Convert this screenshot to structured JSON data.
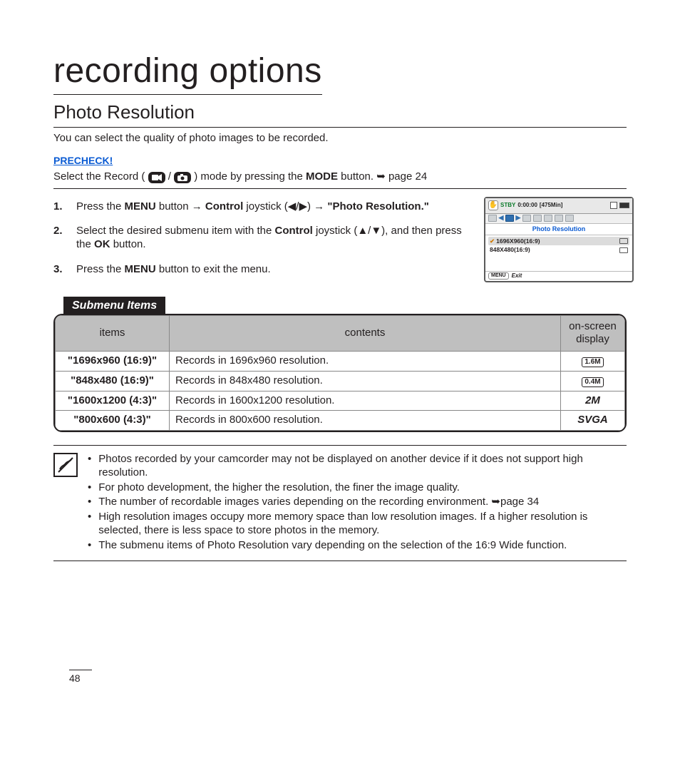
{
  "page_number": "48",
  "title": "recording options",
  "section": "Photo Resolution",
  "intro": "You can select the quality of photo images to be recorded.",
  "precheck_label": "PRECHECK!",
  "modeline": {
    "pre": "Select the Record ( ",
    "sep": " / ",
    "post": " ) mode by pressing the ",
    "mode_word": "MODE",
    "tail": " button. ",
    "pageref": "page 24"
  },
  "steps": [
    {
      "num": "1.",
      "parts": [
        "Press the ",
        "MENU",
        " button ",
        "→",
        " ",
        "Control",
        " joystick (◀/▶) ",
        "→",
        " ",
        "\"Photo Resolution.\""
      ],
      "bold_idx": [
        1,
        5,
        9
      ]
    },
    {
      "num": "2.",
      "parts": [
        "Select the desired submenu item with the ",
        "Control",
        " joystick (▲/▼), and then press the ",
        "OK",
        " button."
      ],
      "bold_idx": [
        1,
        3
      ]
    },
    {
      "num": "3.",
      "parts": [
        "Press the ",
        "MENU",
        " button to exit the menu."
      ],
      "bold_idx": [
        1
      ]
    }
  ],
  "screen": {
    "stby": "STBY",
    "time": "0:00:00",
    "remain": "[475Min]",
    "title": "Photo Resolution",
    "items": [
      {
        "label": "1696X960(16:9)",
        "selected": true
      },
      {
        "label": "848X480(16:9)",
        "selected": false
      }
    ],
    "menu_label": "MENU",
    "exit_label": "Exit"
  },
  "submenu": {
    "tag": "Submenu Items",
    "headers": [
      "items",
      "contents",
      "on-screen display"
    ],
    "rows": [
      {
        "item": "\"1696x960 (16:9)\"",
        "content": "Records in 1696x960 resolution.",
        "disp": "1.6M",
        "style": "badge"
      },
      {
        "item": "\"848x480 (16:9)\"",
        "content": "Records in 848x480 resolution.",
        "disp": "0.4M",
        "style": "badge"
      },
      {
        "item": "\"1600x1200 (4:3)\"",
        "content": "Records in 1600x1200 resolution.",
        "disp": "2M",
        "style": "plain"
      },
      {
        "item": "\"800x600 (4:3)\"",
        "content": "Records in 800x600 resolution.",
        "disp": "SVGA",
        "style": "plain"
      }
    ]
  },
  "notes": [
    "Photos recorded by your camcorder may not be displayed on another device if it does not support high resolution.",
    "For photo development, the higher the resolution, the finer the image quality.",
    "The number of recordable images varies depending on the recording environment. ➥page 34",
    "High resolution images occupy more memory space than low resolution images. If a higher resolution is selected, there is less space to store photos in the memory.",
    "The submenu items of Photo Resolution vary depending on the selection of the 16:9 Wide function."
  ]
}
